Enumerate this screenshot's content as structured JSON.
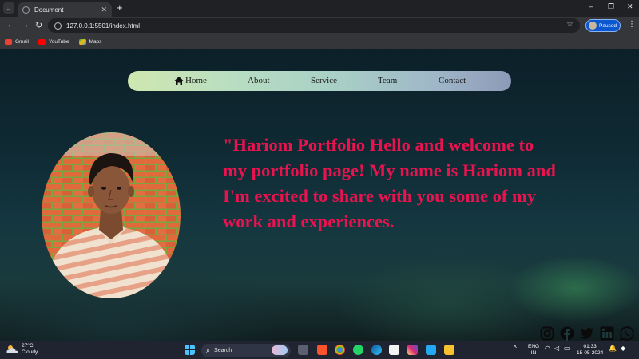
{
  "browser": {
    "tab_title": "Document",
    "tab_close": "✕",
    "new_tab": "+",
    "address": "127.0.0.1:5501/index.html",
    "profile_status": "Paused",
    "window_controls": {
      "minimize": "–",
      "restore": "❐",
      "close": "✕"
    },
    "bookmarks": [
      {
        "label": "Gmail",
        "icon": "gmail-icon",
        "color": "#ea4335"
      },
      {
        "label": "YouTube",
        "icon": "youtube-icon",
        "color": "#ff0000"
      },
      {
        "label": "Maps",
        "icon": "maps-icon",
        "color": "#34a853"
      }
    ]
  },
  "site": {
    "nav": {
      "home": "Home",
      "about": "About",
      "service": "Service",
      "team": "Team",
      "contact": "Contact"
    },
    "hero_text": "\"Hariom Portfolio Hello and welcome to my portfolio page! My name is Hariom and I'm excited to share with you some of my work and experiences.",
    "accent_color": "#e8134f",
    "socials": [
      "instagram-icon",
      "facebook-icon",
      "twitter-icon",
      "linkedin-icon",
      "whatsapp-icon"
    ]
  },
  "taskbar": {
    "weather_temp": "27°C",
    "weather_desc": "Cloudy",
    "search_label": "Search",
    "lang_1": "ENG",
    "lang_2": "IN",
    "time": "01:33",
    "date": "15-05-2024"
  }
}
